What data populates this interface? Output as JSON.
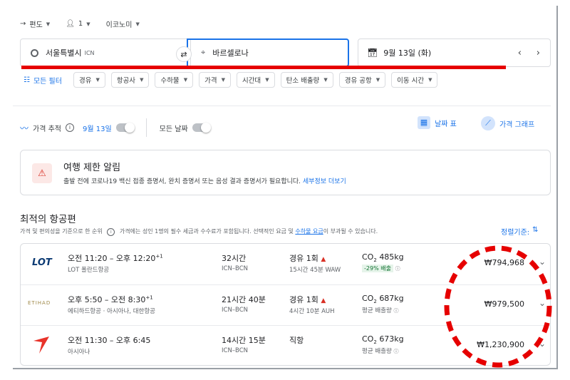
{
  "search": {
    "trip_type": "편도",
    "passengers": "1",
    "cabin": "이코노미",
    "origin": "서울특별시",
    "origin_code": "ICN",
    "destination": "바르셀로나",
    "date": "9월 13일 (화)"
  },
  "filters": {
    "all_filters": "모든 필터",
    "chips": [
      "경유",
      "항공사",
      "수하물",
      "가격",
      "시간대",
      "탄소 배출량",
      "경유 공항",
      "이동 시간"
    ]
  },
  "tracking": {
    "label": "가격 추적",
    "date": "9월 13일",
    "any_dates": "모든 날짜",
    "date_grid": "날짜 표",
    "price_graph": "가격 그래프"
  },
  "alert": {
    "title": "여행 제한 알림",
    "body": "출발 전에 코로나19 백신 접종 증명서, 완치 증명서 또는 음성 결과 증명서가 필요합니다.",
    "link": "세부정보 더보기"
  },
  "results": {
    "heading": "최적의 항공편",
    "subtitle": "가격 및 편의성을 기준으로 한 순위",
    "note_pre": "가격에는 성인 1명의 필수 세금과 수수료가 포함됩니다. 선택적인 요금 및",
    "note_link": "수하물 요금",
    "note_post": "이 부과될 수 있습니다.",
    "sort": "정렬기준:",
    "flights": [
      {
        "logo": "LOT",
        "times": "오전 11:20 – 오후 12:20",
        "plus": "+1",
        "airline": "LOT 폴란드항공",
        "duration": "32시간",
        "route": "ICN–BCN",
        "stops": "경유 1회",
        "layover": "15시간 45분 WAW",
        "co2": "485kg",
        "co2_note": "-29% 배출",
        "price": "₩794,968"
      },
      {
        "logo": "ETIHAD",
        "times": "오후 5:50 – 오전 8:30",
        "plus": "+1",
        "airline": "에티하드항공 · 아시아나, 대한항공",
        "duration": "21시간 40분",
        "route": "ICN–BCN",
        "stops": "경유 1회",
        "layover": "4시간 10분 AUH",
        "co2": "687kg",
        "co2_note": "평균 배출량",
        "price": "₩979,500"
      },
      {
        "logo": "asiana",
        "times": "오전 11:30 – 오후 6:45",
        "plus": "",
        "airline": "아시아나",
        "duration": "14시간 15분",
        "route": "ICN–BCN",
        "stops": "직항",
        "layover": "",
        "co2": "673kg",
        "co2_note": "평균 배출량",
        "price": "₩1,230,900"
      }
    ]
  },
  "colors": {
    "blue": "#1a73e8",
    "red_annotation": "#e60000",
    "alert_red": "#d93025",
    "green": "#137333"
  }
}
